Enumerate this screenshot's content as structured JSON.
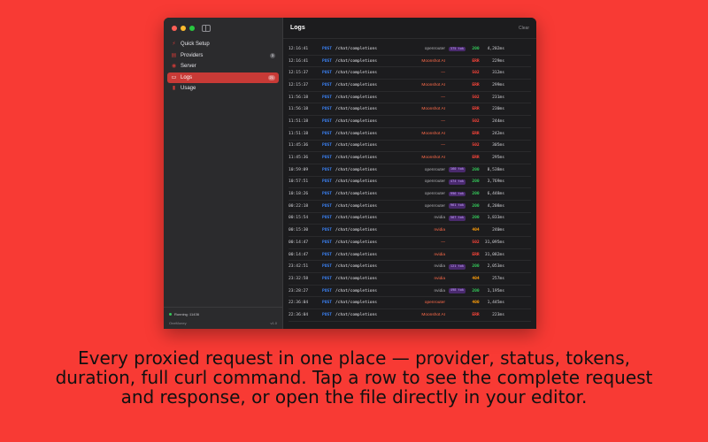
{
  "colors": {
    "background": "#f83a34",
    "accent": "#c83a36",
    "traffic": [
      "#ff5f57",
      "#febc2e",
      "#28c840"
    ],
    "status_ok": "#34c759",
    "status_err": "#ff453a",
    "status_warn": "#ff9f0a",
    "method": "#3b82f6",
    "provider_default": "#aeaeb2",
    "provider_error": "#ff6b4a"
  },
  "sidebar": {
    "items": [
      {
        "label": "Quick Setup",
        "icon": "bolt-icon",
        "glyph": "⚡",
        "badge": ""
      },
      {
        "label": "Providers",
        "icon": "server-stack-icon",
        "glyph": "▤",
        "badge": "3"
      },
      {
        "label": "Server",
        "icon": "globe-icon",
        "glyph": "◉",
        "badge": ""
      },
      {
        "label": "Logs",
        "icon": "list-icon",
        "glyph": "▭",
        "badge": "21",
        "active": true
      },
      {
        "label": "Usage",
        "icon": "bar-chart-icon",
        "glyph": "▮",
        "badge": ""
      }
    ],
    "footer": {
      "status": "Running :11436",
      "app_name": "OneMoney",
      "version": "v1.0"
    }
  },
  "main": {
    "title": "Logs",
    "clear_label": "Clear",
    "rows": [
      {
        "time": "12:16:41",
        "method": "POST",
        "path": "/chat/completions",
        "provider": "openrouter",
        "tokens": "375 tok",
        "status": "200",
        "duration": "4,202ms"
      },
      {
        "time": "12:16:41",
        "method": "POST",
        "path": "/chat/completions",
        "provider": "Moonshot AI",
        "tokens": "",
        "status": "ERR",
        "duration": "229ms"
      },
      {
        "time": "12:15:37",
        "method": "POST",
        "path": "/chat/completions",
        "provider": "—",
        "tokens": "",
        "status": "502",
        "duration": "312ms"
      },
      {
        "time": "12:15:37",
        "method": "POST",
        "path": "/chat/completions",
        "provider": "Moonshot AI",
        "tokens": "",
        "status": "ERR",
        "duration": "299ms"
      },
      {
        "time": "11:56:18",
        "method": "POST",
        "path": "/chat/completions",
        "provider": "—",
        "tokens": "",
        "status": "502",
        "duration": "231ms"
      },
      {
        "time": "11:56:18",
        "method": "POST",
        "path": "/chat/completions",
        "provider": "Moonshot AI",
        "tokens": "",
        "status": "ERR",
        "duration": "230ms"
      },
      {
        "time": "11:51:18",
        "method": "POST",
        "path": "/chat/completions",
        "provider": "—",
        "tokens": "",
        "status": "502",
        "duration": "244ms"
      },
      {
        "time": "11:51:18",
        "method": "POST",
        "path": "/chat/completions",
        "provider": "Moonshot AI",
        "tokens": "",
        "status": "ERR",
        "duration": "242ms"
      },
      {
        "time": "11:45:36",
        "method": "POST",
        "path": "/chat/completions",
        "provider": "—",
        "tokens": "",
        "status": "502",
        "duration": "305ms"
      },
      {
        "time": "11:45:36",
        "method": "POST",
        "path": "/chat/completions",
        "provider": "Moonshot AI",
        "tokens": "",
        "status": "ERR",
        "duration": "295ms"
      },
      {
        "time": "10:59:09",
        "method": "POST",
        "path": "/chat/completions",
        "provider": "openrouter",
        "tokens": "160 tok",
        "status": "200",
        "duration": "8,538ms"
      },
      {
        "time": "10:57:51",
        "method": "POST",
        "path": "/chat/completions",
        "provider": "openrouter",
        "tokens": "474 tok",
        "status": "200",
        "duration": "3,769ms"
      },
      {
        "time": "10:18:26",
        "method": "POST",
        "path": "/chat/completions",
        "provider": "openrouter",
        "tokens": "996 tok",
        "status": "200",
        "duration": "6,448ms"
      },
      {
        "time": "00:22:18",
        "method": "POST",
        "path": "/chat/completions",
        "provider": "openrouter",
        "tokens": "961 tok",
        "status": "200",
        "duration": "4,208ms"
      },
      {
        "time": "00:15:54",
        "method": "POST",
        "path": "/chat/completions",
        "provider": "nvidia",
        "tokens": "567 tok",
        "status": "200",
        "duration": "1,833ms"
      },
      {
        "time": "00:15:30",
        "method": "POST",
        "path": "/chat/completions",
        "provider": "nvidia",
        "tokens": "",
        "status": "404",
        "duration": "240ms"
      },
      {
        "time": "00:14:47",
        "method": "POST",
        "path": "/chat/completions",
        "provider": "—",
        "tokens": "",
        "status": "502",
        "duration": "31,095ms"
      },
      {
        "time": "00:14:47",
        "method": "POST",
        "path": "/chat/completions",
        "provider": "nvidia",
        "tokens": "",
        "status": "ERR",
        "duration": "31,082ms"
      },
      {
        "time": "23:42:51",
        "method": "POST",
        "path": "/chat/completions",
        "provider": "nvidia",
        "tokens": "121 tok",
        "status": "200",
        "duration": "2,053ms"
      },
      {
        "time": "23:32:58",
        "method": "POST",
        "path": "/chat/completions",
        "provider": "nvidia",
        "tokens": "",
        "status": "404",
        "duration": "257ms"
      },
      {
        "time": "23:28:27",
        "method": "POST",
        "path": "/chat/completions",
        "provider": "nvidia",
        "tokens": "498 tok",
        "status": "200",
        "duration": "1,195ms"
      },
      {
        "time": "22:36:04",
        "method": "POST",
        "path": "/chat/completions",
        "provider": "openrouter",
        "tokens": "",
        "status": "400",
        "duration": "1,445ms"
      },
      {
        "time": "22:36:04",
        "method": "POST",
        "path": "/chat/completions",
        "provider": "Moonshot AI",
        "tokens": "",
        "status": "ERR",
        "duration": "223ms"
      }
    ]
  },
  "caption": "Every proxied request in one place — provider, status, tokens, duration, full curl command. Tap a row to see the complete request and response, or open the file directly in your editor."
}
